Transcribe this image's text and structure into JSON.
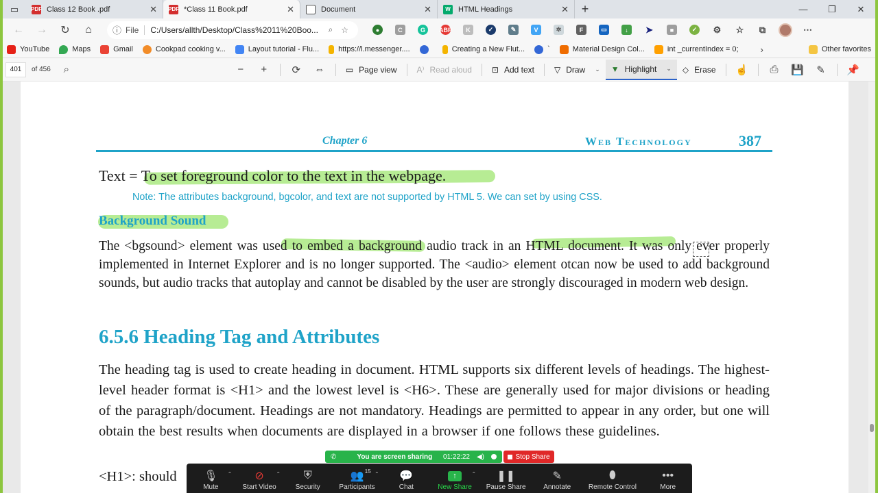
{
  "browser": {
    "tabs": [
      {
        "title": "Class 12 Book .pdf",
        "icon": "pdf-icon",
        "color": "#d32f2f",
        "active": false
      },
      {
        "title": "*Class 11 Book.pdf",
        "icon": "pdf-icon",
        "color": "#d32f2f",
        "active": true
      },
      {
        "title": "Document",
        "icon": "document-icon",
        "color": "#555555",
        "active": false
      },
      {
        "title": "HTML Headings",
        "icon": "w3schools-icon",
        "color": "#04aa6d",
        "active": false
      }
    ],
    "file_label": "File",
    "url": "C:/Users/allth/Desktop/Class%2011%20Boo...",
    "favorites": [
      {
        "label": "YouTube",
        "color": "#e62117"
      },
      {
        "label": "Maps",
        "color": "#34a853"
      },
      {
        "label": "Gmail",
        "color": "#ea4335"
      },
      {
        "label": "Cookpad cooking v...",
        "color": "#f28c28"
      },
      {
        "label": "Layout tutorial - Flu...",
        "color": "#4285f4"
      },
      {
        "label": "https://l.messenger....",
        "color": "#f4b400"
      },
      {
        "label": "Creating a New Flut...",
        "color": "#f4b400"
      },
      {
        "label": "`",
        "color": "#3367d6"
      },
      {
        "label": "Material Design Col...",
        "color": "#ef6c00"
      },
      {
        "label": "int _currentIndex = 0;",
        "color": "#ffa000"
      }
    ],
    "other_favorites": "Other favorites"
  },
  "pdf_toolbar": {
    "page": "401",
    "page_count": "of 456",
    "page_view": "Page view",
    "read_aloud": "Read aloud",
    "add_text": "Add text",
    "draw": "Draw",
    "highlight": "Highlight",
    "erase": "Erase"
  },
  "document": {
    "chapter": "Chapter 6",
    "running_title": "Web Technology",
    "page_number": "387",
    "text_line": "Text = To set foreground color to the text in the webpage.",
    "note": "Note: The attributes background, bgcolor, and text are not supported by HTML 5. We can set by using CSS.",
    "bgsound_heading": "Background Sound",
    "bgsound_para": "The <bgsound> element was used to embed a background audio track in an HTML document. It was only ever properly implemented in Internet Explorer and is no longer supported. The <audio> element otcan now be used to add background sounds, but audio tracks that autoplay and cannot be disabled by the user are strongly discouraged in modern web design.",
    "section_heading": "6.5.6  Heading Tag and Attributes",
    "heading_para": "The heading tag is used to create heading in document. HTML supports six different levels of headings. The highest-level header format is <H1> and the lowest level is <H6>. These are generally used for major divisions or heading of the paragraph/document. Headings are not mandatory. Headings are permitted to appear in any order, but one will obtain the best results when documents are displayed in a browser if one follows these guidelines.",
    "h1_line": "<H1>: should"
  },
  "zoom": {
    "sharing_text": "You are screen sharing",
    "timer": "01:22:22",
    "stop_share": "Stop Share",
    "participants_count": "15",
    "buttons": [
      "Mute",
      "Start Video",
      "Security",
      "Participants",
      "Chat",
      "New Share",
      "Pause Share",
      "Annotate",
      "Remote Control",
      "More"
    ]
  }
}
